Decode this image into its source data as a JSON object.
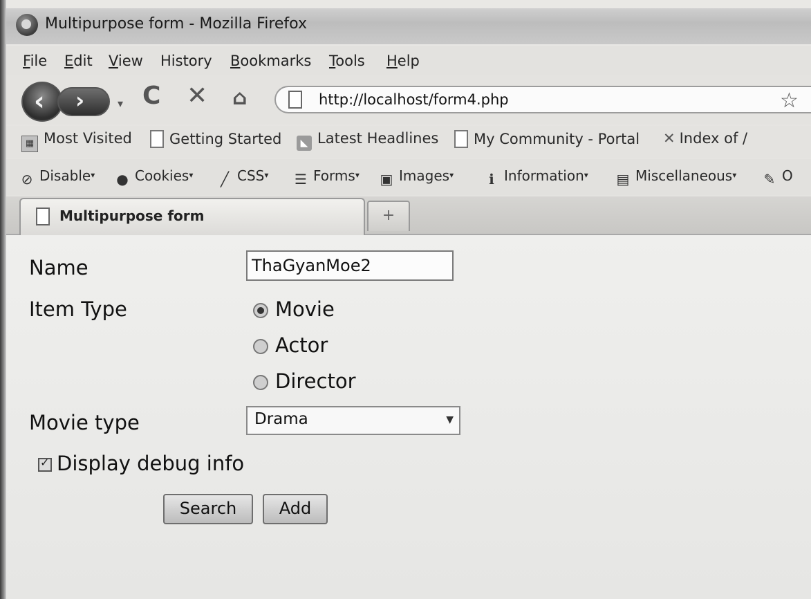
{
  "window": {
    "title": "Multipurpose form - Mozilla Firefox"
  },
  "menubar": {
    "items": [
      {
        "label": "File",
        "key": "F",
        "rest": "ile"
      },
      {
        "label": "Edit",
        "key": "E",
        "rest": "dit"
      },
      {
        "label": "View",
        "key": "V",
        "rest": "iew"
      },
      {
        "label": "History",
        "key": "",
        "rest": "History"
      },
      {
        "label": "Bookmarks",
        "key": "B",
        "rest": "ookmarks"
      },
      {
        "label": "Tools",
        "key": "T",
        "rest": "ools"
      },
      {
        "label": "Help",
        "key": "H",
        "rest": "elp"
      }
    ]
  },
  "navbar": {
    "url": "http://localhost/form4.php"
  },
  "bookmarks": {
    "most_visited": "Most Visited",
    "getting_started": "Getting Started",
    "latest_headlines": "Latest Headlines",
    "my_community": "My Community - Portal",
    "index_of": "Index of /"
  },
  "devbar": {
    "disable": "Disable",
    "cookies": "Cookies",
    "css": "CSS",
    "forms": "Forms",
    "images": "Images",
    "information": "Information",
    "miscellaneous": "Miscellaneous",
    "outline": "O"
  },
  "tab": {
    "label": "Multipurpose form",
    "new_tab": "+"
  },
  "form": {
    "name_label": "Name",
    "name_value": "ThaGyanMoe2",
    "item_type_label": "Item Type",
    "item_types": [
      "Movie",
      "Actor",
      "Director"
    ],
    "item_type_selected": "Movie",
    "movie_type_label": "Movie type",
    "movie_type_value": "Drama",
    "debug_label": "Display debug info",
    "debug_checked": true,
    "search_button": "Search",
    "add_button": "Add"
  },
  "icons": {
    "back": "back-arrow-icon",
    "forward": "forward-arrow-icon",
    "reload": "reload-icon",
    "stop": "stop-icon",
    "home": "home-icon",
    "bookmark_star": "star-icon"
  }
}
